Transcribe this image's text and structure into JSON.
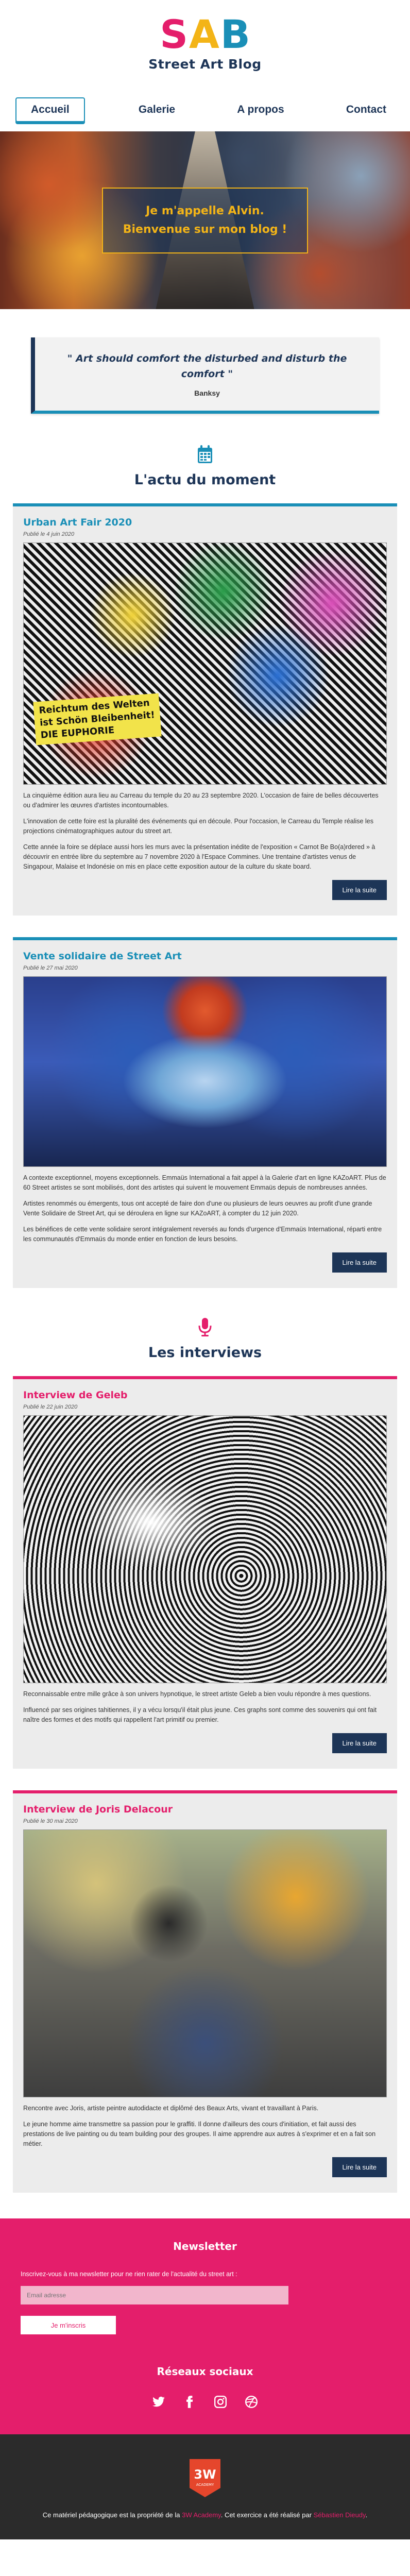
{
  "header": {
    "logo_letters": [
      "S",
      "A",
      "B"
    ],
    "title": "Street Art Blog"
  },
  "nav": {
    "items": [
      {
        "label": "Accueil",
        "active": true
      },
      {
        "label": "Galerie",
        "active": false
      },
      {
        "label": "A propos",
        "active": false
      },
      {
        "label": "Contact",
        "active": false
      }
    ]
  },
  "hero": {
    "line1": "Je m'appelle Alvin.",
    "line2": "Bienvenue sur mon blog !"
  },
  "quote": {
    "text": "\" Art should comfort the disturbed and disturb the comfort \"",
    "author": "Banksy"
  },
  "news": {
    "icon": "calendar-icon",
    "title": "L'actu du moment",
    "articles": [
      {
        "title": "Urban Art Fair 2020",
        "date": "Publié le 4 juin 2020",
        "image_text": [
          "Reichtum des Welten",
          "ist Schön Bleibenheit!",
          "DIE EUPHORIE"
        ],
        "paragraphs": [
          "La cinquième édition aura lieu au Carreau du temple du 20 au 23 septembre 2020. L'occasion de faire de belles découvertes ou d'admirer les œuvres d'artistes incontournables.",
          "L'innovation de cette foire est la pluralité des événements qui en découle. Pour l'occasion, le Carreau du Temple réalise les projections cinématographiques autour du street art.",
          "Cette année la foire se déplace aussi hors les murs avec la présentation inédite de l'exposition « Carnot Be Bo(a)rdered » à découvrir en entrée libre du septembre au 7 novembre 2020 à l'Espace Commines. Une trentaine d'artistes venus de Singapour, Malaise et Indonésie on mis en place cette exposition autour de la culture du skate board."
        ],
        "button": "Lire la suite"
      },
      {
        "title": "Vente solidaire de Street Art",
        "date": "Publié le 27 mai 2020",
        "paragraphs": [
          "A contexte exceptionnel, moyens exceptionnels. Emmaüs International a fait appel à la Galerie d'art en ligne KAZoART. Plus de 60 Street artistes se sont mobilisés, dont des artistes qui suivent le mouvement Emmaüs depuis de nombreuses années.",
          "Artistes renommés ou émergents, tous ont accepté de faire don d'une ou plusieurs de leurs oeuvres au profit d'une grande Vente Solidaire de Street Art, qui se déroulera en ligne sur KAZoART, à compter du 12 juin 2020.",
          "Les bénéfices de cette vente solidaire seront intégralement reversés au fonds d'urgence d'Emmaüs International, réparti entre les communautés d'Emmaüs du monde entier en fonction de leurs besoins."
        ],
        "button": "Lire la suite"
      }
    ]
  },
  "interviews": {
    "icon": "microphone-icon",
    "title": "Les interviews",
    "articles": [
      {
        "title": "Interview de Geleb",
        "date": "Publié le 22 juin 2020",
        "paragraphs": [
          "Reconnaissable entre mille grâce à son univers hypnotique, le street artiste Geleb a bien voulu répondre à mes questions.",
          "Influencé par ses origines tahitiennes, il y a vécu lorsqu'il était plus jeune. Ces graphs sont comme des souvenirs qui ont fait naître des formes et des motifs qui rappellent l'art primitif ou premier."
        ],
        "button": "Lire la suite"
      },
      {
        "title": "Interview de Joris Delacour",
        "date": "Publié le 30 mai 2020",
        "paragraphs": [
          "Rencontre avec Joris, artiste peintre autodidacte et diplômé des Beaux Arts, vivant et travaillant à Paris.",
          "Le jeune homme aime transmettre sa passion pour le graffiti. Il donne d'ailleurs des cours d'initiation, et fait aussi des prestations de live painting ou du team building pour des groupes. Il aime apprendre aux autres à s'exprimer et en a fait son métier."
        ],
        "button": "Lire la suite"
      }
    ]
  },
  "newsletter": {
    "title": "Newsletter",
    "text": "Inscrivez-vous à ma newsletter pour ne rien rater de l'actualité du street art :",
    "placeholder": "Email adresse",
    "button": "Je m'inscris"
  },
  "social": {
    "title": "Réseaux sociaux",
    "icons": [
      "twitter-icon",
      "facebook-icon",
      "instagram-icon",
      "dribbble-icon"
    ]
  },
  "footer": {
    "logo_text": "3W",
    "logo_sub": "ACADEMY",
    "text_before": "Ce matériel pédagogique est la propriété de la ",
    "link1": "3W Academy",
    "text_middle": ". Cet exercice a été réalisé par ",
    "link2": "Sébastien Dieudy",
    "text_after": "."
  },
  "colors": {
    "pink": "#e41e6b",
    "yellow": "#f3b417",
    "blue": "#1a8fb7",
    "navy": "#1d3557"
  }
}
